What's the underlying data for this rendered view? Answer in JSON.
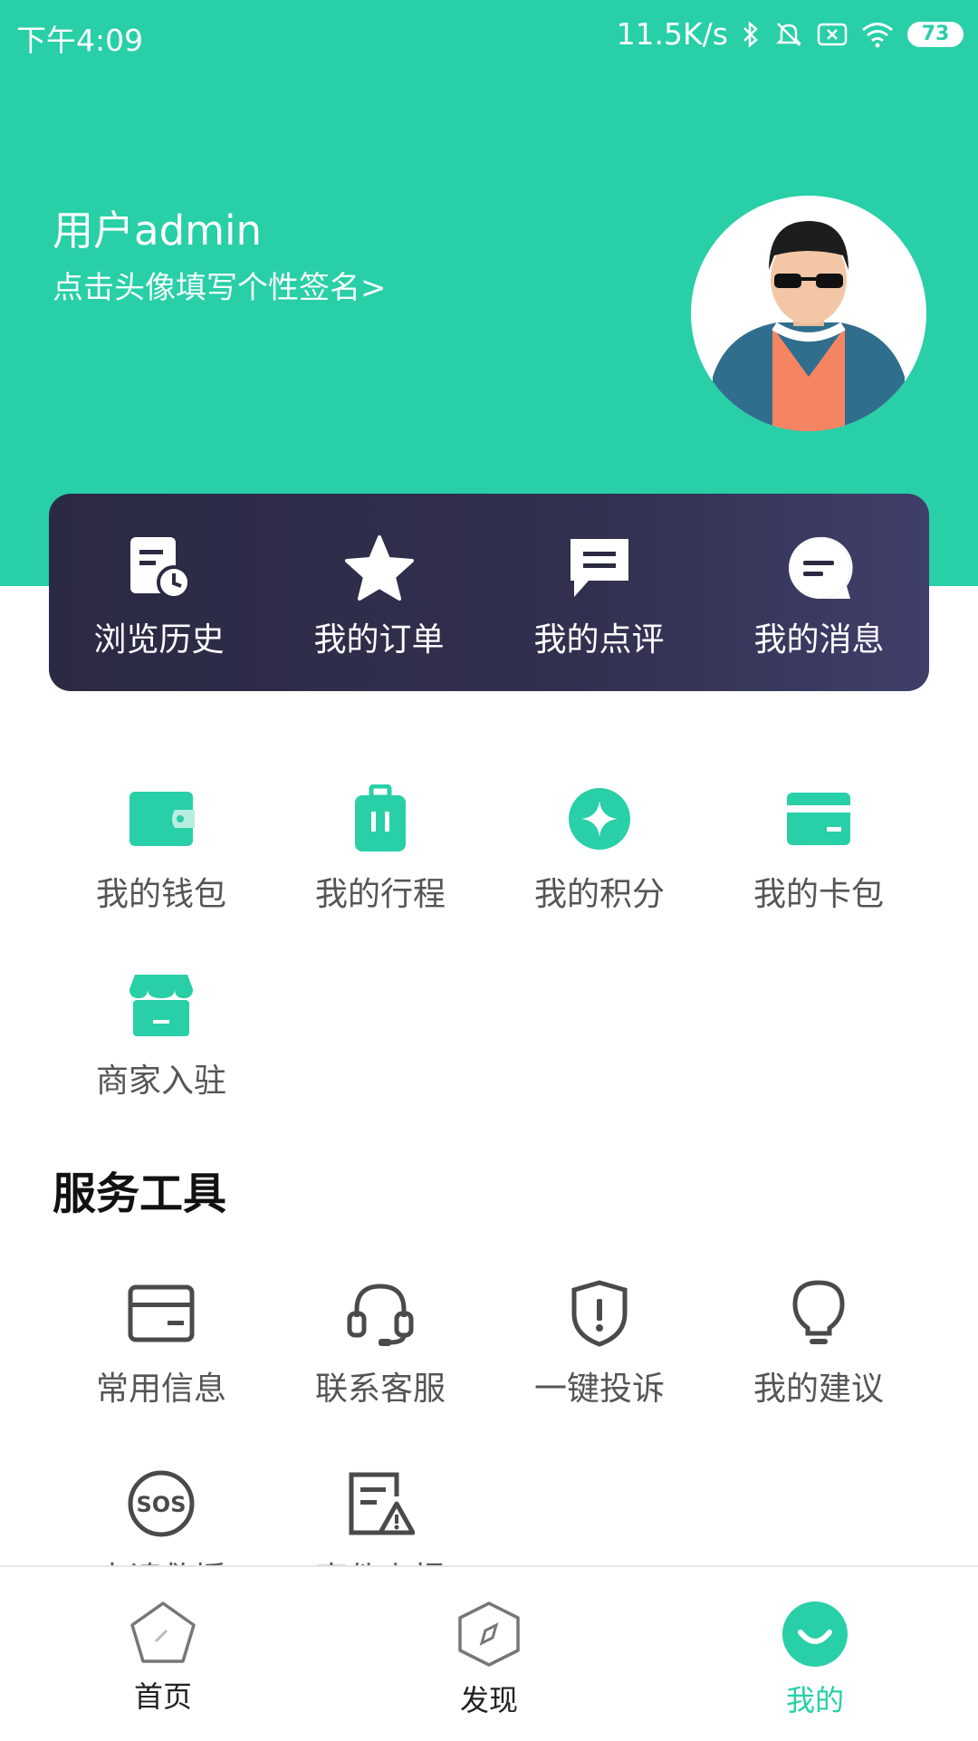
{
  "status_bar": {
    "time": "下午4:09",
    "network_speed": "11.5K/s",
    "battery": "73",
    "icons": [
      "bluetooth-icon",
      "mute-bell-icon",
      "no-sim-icon",
      "wifi-icon",
      "battery-icon"
    ]
  },
  "profile": {
    "username": "用户admin",
    "signature_hint": "点击头像填写个性签名>"
  },
  "quick_actions": [
    {
      "label": "浏览历史",
      "icon": "history-icon"
    },
    {
      "label": "我的订单",
      "icon": "star-icon"
    },
    {
      "label": "我的点评",
      "icon": "comment-icon"
    },
    {
      "label": "我的消息",
      "icon": "message-icon"
    }
  ],
  "features": [
    {
      "label": "我的钱包",
      "icon": "wallet-icon"
    },
    {
      "label": "我的行程",
      "icon": "luggage-icon"
    },
    {
      "label": "我的积分",
      "icon": "points-icon"
    },
    {
      "label": "我的卡包",
      "icon": "card-icon"
    },
    {
      "label": "商家入驻",
      "icon": "store-icon"
    }
  ],
  "services": {
    "title": "服务工具",
    "items": [
      {
        "label": "常用信息",
        "icon": "info-card-icon"
      },
      {
        "label": "联系客服",
        "icon": "headset-icon"
      },
      {
        "label": "一键投诉",
        "icon": "shield-alert-icon"
      },
      {
        "label": "我的建议",
        "icon": "lightbulb-icon"
      },
      {
        "label": "申请救援",
        "icon": "sos-icon"
      },
      {
        "label": "事件上报",
        "icon": "report-icon"
      }
    ]
  },
  "tabbar": [
    {
      "label": "首页",
      "icon": "home-pentagon-icon"
    },
    {
      "label": "发现",
      "icon": "compass-icon"
    },
    {
      "label": "我的",
      "icon": "smile-icon"
    }
  ],
  "colors": {
    "accent": "#28cfa7",
    "card_dark": "#2b2a44",
    "text_gray": "#555555",
    "icon_gray": "#4a4a4a"
  }
}
